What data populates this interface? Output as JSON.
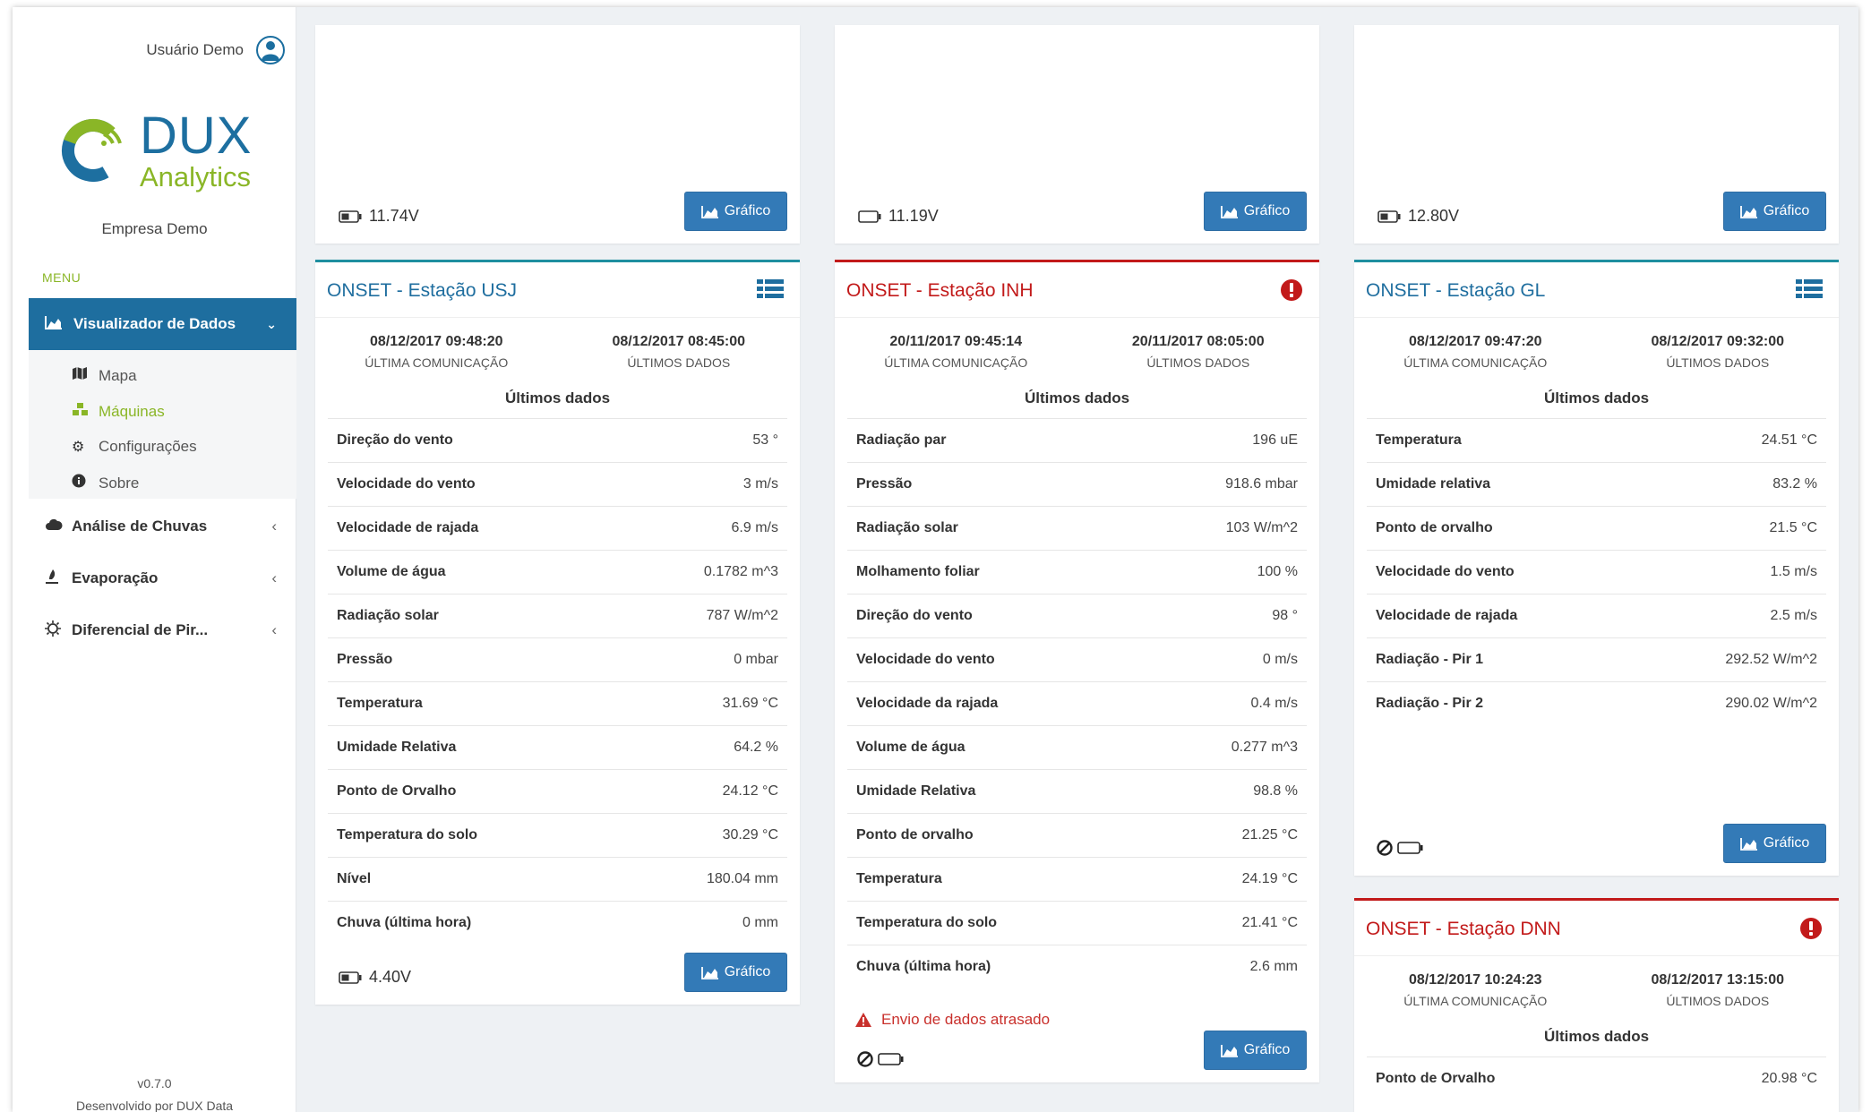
{
  "user": {
    "name": "Usuário Demo",
    "icon": "user-circle-icon"
  },
  "logo": {
    "brand": "DUX",
    "tagline": "Analytics"
  },
  "company": "Empresa Demo",
  "menu_label": "MENU",
  "nav": {
    "active": {
      "label": "Visualizador de Dados",
      "icon": "area-chart-icon"
    },
    "subitems": [
      {
        "label": "Mapa",
        "icon": "map-icon"
      },
      {
        "label": "Máquinas",
        "icon": "cubes-icon"
      },
      {
        "label": "Configurações",
        "icon": "gear-icon"
      },
      {
        "label": "Sobre",
        "icon": "info-icon"
      }
    ],
    "items": [
      {
        "label": "Análise de Chuvas",
        "icon": "cloud-icon"
      },
      {
        "label": "Evaporação",
        "icon": "thermometer-icon"
      },
      {
        "label": "Diferencial de Pir...",
        "icon": "sun-icon"
      }
    ]
  },
  "footer": {
    "version": "v0.7.0",
    "developed_by": "Desenvolvido por DUX Data"
  },
  "common": {
    "grafico": "Gráfico",
    "ultima_comunicacao": "ÚLTIMA COMUNICAÇÃO",
    "ultimos_dados_label": "ÚLTIMOS DADOS",
    "ultimos_dados_title": "Últimos dados"
  },
  "top_cards": [
    {
      "voltage": "11.74V"
    },
    {
      "voltage": "11.19V"
    },
    {
      "voltage": "12.80V"
    }
  ],
  "stations": {
    "usj": {
      "title": "ONSET - Estação USJ",
      "last_comm": "08/12/2017 09:48:20",
      "last_data": "08/12/2017 08:45:00",
      "voltage": "4.40V",
      "rows": [
        {
          "k": "Direção do vento",
          "v": "53 °"
        },
        {
          "k": "Velocidade do vento",
          "v": "3 m/s"
        },
        {
          "k": "Velocidade de rajada",
          "v": "6.9 m/s"
        },
        {
          "k": "Volume de água",
          "v": "0.1782 m^3"
        },
        {
          "k": "Radiação solar",
          "v": "787 W/m^2"
        },
        {
          "k": "Pressão",
          "v": "0 mbar"
        },
        {
          "k": "Temperatura",
          "v": "31.69 °C"
        },
        {
          "k": "Umidade Relativa",
          "v": "64.2 %"
        },
        {
          "k": "Ponto de Orvalho",
          "v": "24.12 °C"
        },
        {
          "k": "Temperatura do solo",
          "v": "30.29 °C"
        },
        {
          "k": "Nível",
          "v": "180.04 mm"
        },
        {
          "k": "Chuva (última hora)",
          "v": "0 mm"
        }
      ]
    },
    "inh": {
      "title": "ONSET - Estação INH",
      "last_comm": "20/11/2017 09:45:14",
      "last_data": "20/11/2017 08:05:00",
      "warning": "Envio de dados atrasado",
      "rows": [
        {
          "k": "Radiação par",
          "v": "196 uE"
        },
        {
          "k": "Pressão",
          "v": "918.6 mbar"
        },
        {
          "k": "Radiação solar",
          "v": "103 W/m^2"
        },
        {
          "k": "Molhamento foliar",
          "v": "100 %"
        },
        {
          "k": "Direção do vento",
          "v": "98 °"
        },
        {
          "k": "Velocidade do vento",
          "v": "0 m/s"
        },
        {
          "k": "Velocidade da rajada",
          "v": "0.4 m/s"
        },
        {
          "k": "Volume de água",
          "v": "0.277 m^3"
        },
        {
          "k": "Umidade Relativa",
          "v": "98.8 %"
        },
        {
          "k": "Ponto de orvalho",
          "v": "21.25 °C"
        },
        {
          "k": "Temperatura",
          "v": "24.19 °C"
        },
        {
          "k": "Temperatura do solo",
          "v": "21.41 °C"
        },
        {
          "k": "Chuva (última hora)",
          "v": "2.6 mm"
        }
      ]
    },
    "gl": {
      "title": "ONSET - Estação GL",
      "last_comm": "08/12/2017 09:47:20",
      "last_data": "08/12/2017 09:32:00",
      "rows": [
        {
          "k": "Temperatura",
          "v": "24.51 °C"
        },
        {
          "k": "Umidade relativa",
          "v": "83.2 %"
        },
        {
          "k": "Ponto de orvalho",
          "v": "21.5 °C"
        },
        {
          "k": "Velocidade do vento",
          "v": "1.5 m/s"
        },
        {
          "k": "Velocidade de rajada",
          "v": "2.5 m/s"
        },
        {
          "k": "Radiação - Pir 1",
          "v": "292.52 W/m^2"
        },
        {
          "k": "Radiação - Pir 2",
          "v": "290.02 W/m^2"
        }
      ]
    },
    "dnn": {
      "title": "ONSET - Estação DNN",
      "last_comm": "08/12/2017 10:24:23",
      "last_data": "08/12/2017 13:15:00",
      "rows": [
        {
          "k": "Ponto de Orvalho",
          "v": "20.98 °C"
        }
      ]
    }
  },
  "colors": {
    "primary": "#1e6e9f",
    "accent": "#8ab627",
    "error": "#c21a1a",
    "teal": "#1f8fa0"
  }
}
